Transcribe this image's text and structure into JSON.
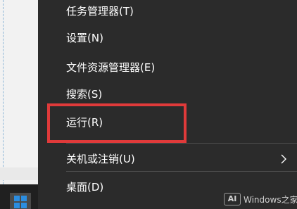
{
  "menu": {
    "items": [
      {
        "label": "任务管理器(T)"
      },
      {
        "label": "设置(N)"
      },
      {
        "label": "文件资源管理器(E)"
      },
      {
        "label": "搜索(S)"
      },
      {
        "label": "运行(R)"
      },
      {
        "label": "关机或注销(U)",
        "has_submenu": true
      },
      {
        "label": "桌面(D)"
      }
    ],
    "highlighted_item": "运行(R)",
    "highlight_color": "#e03a3a",
    "background_color": "#2b2b2b"
  },
  "watermark": {
    "logo_text": "AI",
    "text": "Windows之家"
  },
  "colors": {
    "taskbar": "#202020",
    "start_logo": "#2b8de0"
  }
}
